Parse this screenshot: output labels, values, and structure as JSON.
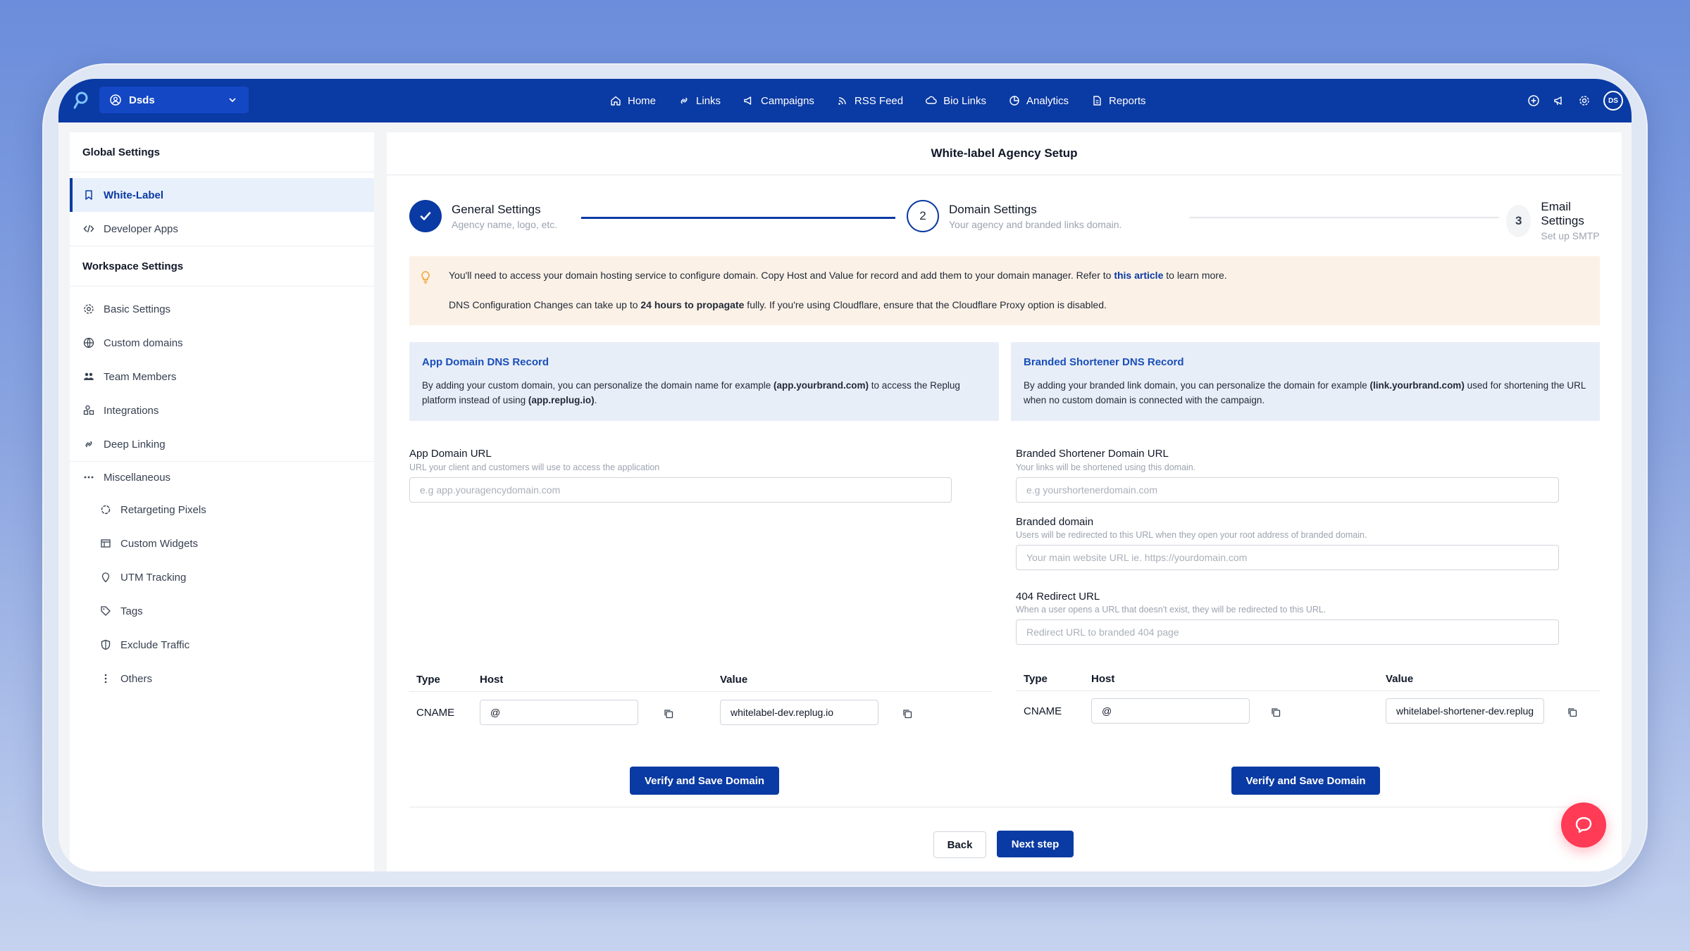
{
  "workspace": {
    "name": "Dsds"
  },
  "nav": {
    "links": [
      {
        "label": "Home",
        "icon": "home-icon"
      },
      {
        "label": "Links",
        "icon": "link-icon"
      },
      {
        "label": "Campaigns",
        "icon": "megaphone-icon"
      },
      {
        "label": "RSS Feed",
        "icon": "rss-icon"
      },
      {
        "label": "Bio Links",
        "icon": "cloud-link-icon"
      },
      {
        "label": "Analytics",
        "icon": "analytics-icon"
      },
      {
        "label": "Reports",
        "icon": "report-icon"
      }
    ],
    "avatar_initials": "DS"
  },
  "sidebar": {
    "global_heading": "Global Settings",
    "global_items": [
      {
        "label": "White-Label",
        "icon": "bookmark-icon",
        "active": true
      },
      {
        "label": "Developer Apps",
        "icon": "code-icon"
      }
    ],
    "workspace_heading": "Workspace Settings",
    "workspace_items": [
      {
        "label": "Basic Settings",
        "icon": "gear-icon"
      },
      {
        "label": "Custom domains",
        "icon": "globe-icon"
      },
      {
        "label": "Team Members",
        "icon": "users-icon"
      },
      {
        "label": "Integrations",
        "icon": "integrations-icon"
      },
      {
        "label": "Deep Linking",
        "icon": "link-icon"
      }
    ],
    "misc_label": "Miscellaneous",
    "misc_items": [
      {
        "label": "Retargeting Pixels",
        "icon": "pixel-icon"
      },
      {
        "label": "Custom Widgets",
        "icon": "widget-icon"
      },
      {
        "label": "UTM Tracking",
        "icon": "pin-icon"
      },
      {
        "label": "Tags",
        "icon": "tag-icon"
      },
      {
        "label": "Exclude Traffic",
        "icon": "shield-icon"
      },
      {
        "label": "Others",
        "icon": "more-vertical-icon"
      }
    ]
  },
  "main": {
    "title": "White-label Agency Setup",
    "steps": [
      {
        "title": "General Settings",
        "subtitle": "Agency name, logo, etc.",
        "status": "done",
        "number": "1"
      },
      {
        "title": "Domain Settings",
        "subtitle": "Your agency and branded links domain.",
        "status": "current",
        "number": "2"
      },
      {
        "title": "Email Settings",
        "subtitle": "Set up SMTP",
        "status": "pending",
        "number": "3"
      }
    ],
    "notice": {
      "line1_pre": "You'll need to access your domain hosting service to configure domain. Copy Host and Value for record and add them to your domain manager. Refer to ",
      "line1_link": "this article",
      "line1_post": " to learn more.",
      "line2_pre": "DNS Configuration Changes can take up to ",
      "line2_bold": "24 hours to propagate",
      "line2_post": " fully. If you're using Cloudflare, ensure that the Cloudflare Proxy option is disabled."
    },
    "app_card": {
      "title": "App Domain DNS Record",
      "text_pre": "By adding your custom domain, you can personalize the domain name for example ",
      "text_bold1": "(app.yourbrand.com)",
      "text_mid": " to access the Replug platform instead of using ",
      "text_bold2": "(app.replug.io)",
      "text_post": "."
    },
    "branded_card": {
      "title": "Branded Shortener DNS Record",
      "text_pre": "By adding your branded link domain, you can personalize the domain for example ",
      "text_bold": "(link.yourbrand.com)",
      "text_post": " used for shortening the URL when no custom domain is connected with the campaign."
    },
    "app_domain": {
      "label": "App Domain URL",
      "help": "URL your client and customers will use to access the application",
      "placeholder": "e.g app.youragencydomain.com",
      "value": ""
    },
    "shortener_domain": {
      "label": "Branded Shortener Domain URL",
      "help": "Your links will be shortened using this domain.",
      "placeholder": "e.g yourshortenerdomain.com",
      "value": ""
    },
    "branded_domain": {
      "label": "Branded domain",
      "help": "Users will be redirected to this URL when they open your root address of branded domain.",
      "placeholder": "Your main website URL ie. https://yourdomain.com",
      "value": ""
    },
    "redirect_404": {
      "label": "404 Redirect URL",
      "help": "When a user opens a URL that doesn't exist, they will be redirected to this URL.",
      "placeholder": "Redirect URL to branded 404 page",
      "value": ""
    },
    "record_headers": {
      "type": "Type",
      "host": "Host",
      "value": "Value"
    },
    "app_record": {
      "type": "CNAME",
      "host": "@",
      "value": "whitelabel-dev.replug.io"
    },
    "shortener_record": {
      "type": "CNAME",
      "host": "@",
      "value": "whitelabel-shortener-dev.replug.io"
    },
    "verify_label": "Verify and Save Domain",
    "back_label": "Back",
    "next_label": "Next step"
  },
  "colors": {
    "primary": "#0a3aa3",
    "accent_link": "#1a4fb8",
    "notice_bg": "#fcf1e6",
    "card_bg": "#e8eef8",
    "chat": "#ff3b55"
  }
}
